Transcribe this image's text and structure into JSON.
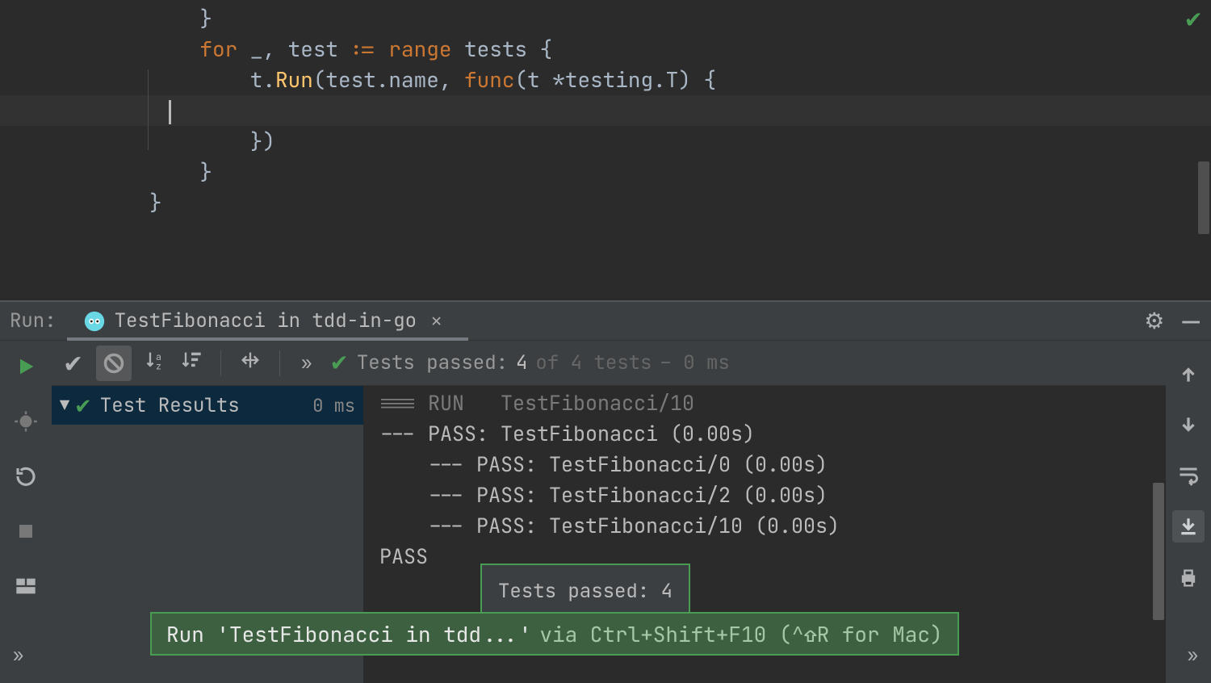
{
  "editor": {
    "lines": {
      "brace_close_inner": "    }",
      "for_kw": "for",
      "for_rest_1": " _, test ",
      "for_op": ":=",
      "range_kw": " range ",
      "for_rest_2": "tests {",
      "run_pre": "        t.",
      "run_fn": "Run",
      "run_args": "(test.name, ",
      "func_kw": "func",
      "run_tail": "(t *testing.T) {",
      "close_paren": "        })",
      "brace_close_mid": "    }",
      "brace_close_outer": "}"
    }
  },
  "run_header": {
    "label": "Run:",
    "tab_title": "TestFibonacci in tdd-in-go"
  },
  "toolbar": {
    "tests_label": "Tests passed:",
    "tests_passed": "4",
    "tests_of": "of 4 tests",
    "tests_time": "– 0 ms"
  },
  "tree": {
    "root_label": "Test Results",
    "root_time": "0 ms"
  },
  "console": {
    "lines": [
      "=== RUN   TestFibonacci/10",
      "--- PASS: TestFibonacci (0.00s)",
      "    --- PASS: TestFibonacci/0 (0.00s)",
      "    --- PASS: TestFibonacci/2 (0.00s)",
      "    --- PASS: TestFibonacci/10 (0.00s)",
      "PASS"
    ]
  },
  "popup": "Tests passed: 4",
  "hint": {
    "strong": "Run 'TestFibonacci in tdd...'",
    "rest": "via Ctrl+Shift+F10 (^⇧R for Mac)"
  }
}
